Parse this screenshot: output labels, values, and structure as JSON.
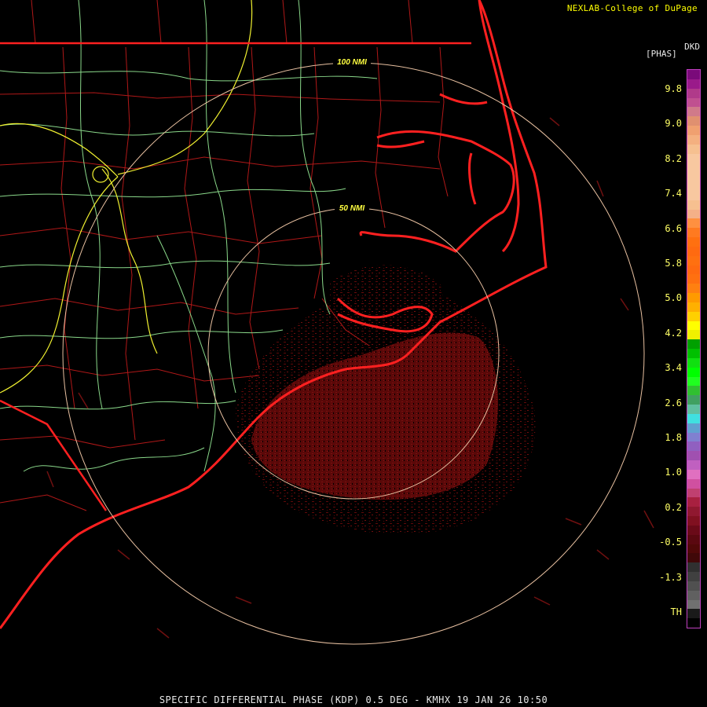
{
  "header": {
    "credit": "NEXLAB-College of DuPage"
  },
  "legend": {
    "product_code": "DKD",
    "units": "[PHAS]",
    "tick_labels": [
      "9.8",
      "9.0",
      "8.2",
      "7.4",
      "6.6",
      "5.8",
      "5.0",
      "4.2",
      "3.4",
      "2.6",
      "1.8",
      "1.0",
      "0.2",
      "-0.5",
      "-1.3",
      "TH"
    ],
    "colors": [
      "#7a0a7a",
      "#9a1a8a",
      "#b03a8a",
      "#c05090",
      "#d07a8a",
      "#e09070",
      "#f0a070",
      "#f4b080",
      "#f6c090",
      "#f8c8a0",
      "#f8c8a0",
      "#f8c8a0",
      "#f8c8a0",
      "#f8c8a0",
      "#f6c090",
      "#f4b088",
      "#ff9040",
      "#ff7a20",
      "#ff7010",
      "#ff6a10",
      "#ff7010",
      "#ff6a10",
      "#ff7010",
      "#ff8010",
      "#ff9a00",
      "#ffb000",
      "#ffd000",
      "#ffff00",
      "#f0f000",
      "#00a000",
      "#00c000",
      "#10e010",
      "#00ff00",
      "#20ff20",
      "#30c030",
      "#40a060",
      "#60c0a0",
      "#40e0e0",
      "#60a0d0",
      "#8080d0",
      "#9060c0",
      "#a050b0",
      "#c060c0",
      "#e070c0",
      "#d050a0",
      "#c04070",
      "#a82040",
      "#901830",
      "#801020",
      "#6a0a18",
      "#5a0810",
      "#500808",
      "#400808",
      "#303030",
      "#404040",
      "#505050",
      "#606060",
      "#707070",
      "#1a1a1a",
      "#000000"
    ]
  },
  "range_rings": {
    "inner_label": "50 NMI",
    "outer_label": "100 NMI"
  },
  "colors": {
    "state_border": "#ff1a1a",
    "county": "#c02020",
    "coast": "#ff2020",
    "interstate": "#ffff40",
    "highway": "#90e090",
    "ring": "#e8c0a0",
    "echo": "#6a0a0a"
  },
  "footer": {
    "title": "SPECIFIC DIFFERENTIAL PHASE (KDP) 0.5 DEG - KMHX 19 JAN 26 10:50"
  }
}
